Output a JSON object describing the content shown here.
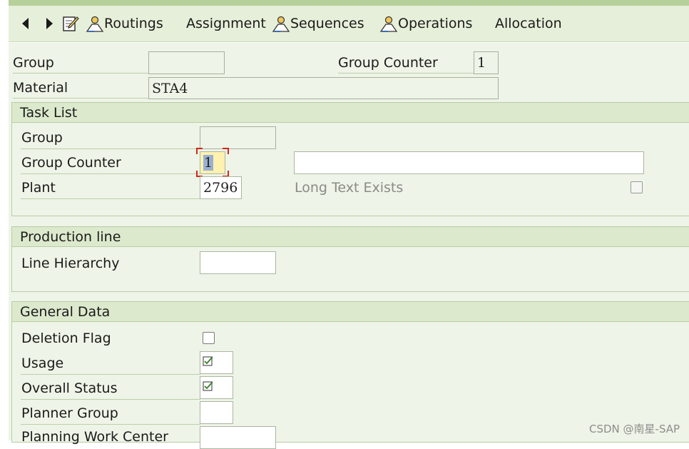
{
  "toolbar": {
    "routings": "Routings",
    "assignment": "Assignment",
    "sequences": "Sequences",
    "operations": "Operations",
    "allocation": "Allocation"
  },
  "header": {
    "group_label": "Group",
    "group_value": "",
    "group_counter_label": "Group Counter",
    "group_counter_value": "1",
    "material_label": "Material",
    "material_value": "STA4"
  },
  "task_list": {
    "title": "Task List",
    "group_label": "Group",
    "group_value": "",
    "group_counter_label": "Group Counter",
    "group_counter_value": "1",
    "description_value": "",
    "plant_label": "Plant",
    "plant_value": "2796",
    "long_text_label": "Long Text Exists"
  },
  "production_line": {
    "title": "Production line",
    "line_hierarchy_label": "Line Hierarchy",
    "line_hierarchy_value": ""
  },
  "general_data": {
    "title": "General Data",
    "deletion_flag_label": "Deletion Flag",
    "usage_label": "Usage",
    "overall_status_label": "Overall Status",
    "planner_group_label": "Planner Group",
    "planning_work_center_label": "Planning Work Center"
  },
  "watermark": "CSDN @南星-SAP",
  "colors": {
    "toolbar_bg": "#e6efd9",
    "section_header_bg": "#dde9cd",
    "content_bg": "#eef4e7",
    "focus_field_bg": "#fff1b0",
    "focus_marker": "#cc2a1a"
  }
}
